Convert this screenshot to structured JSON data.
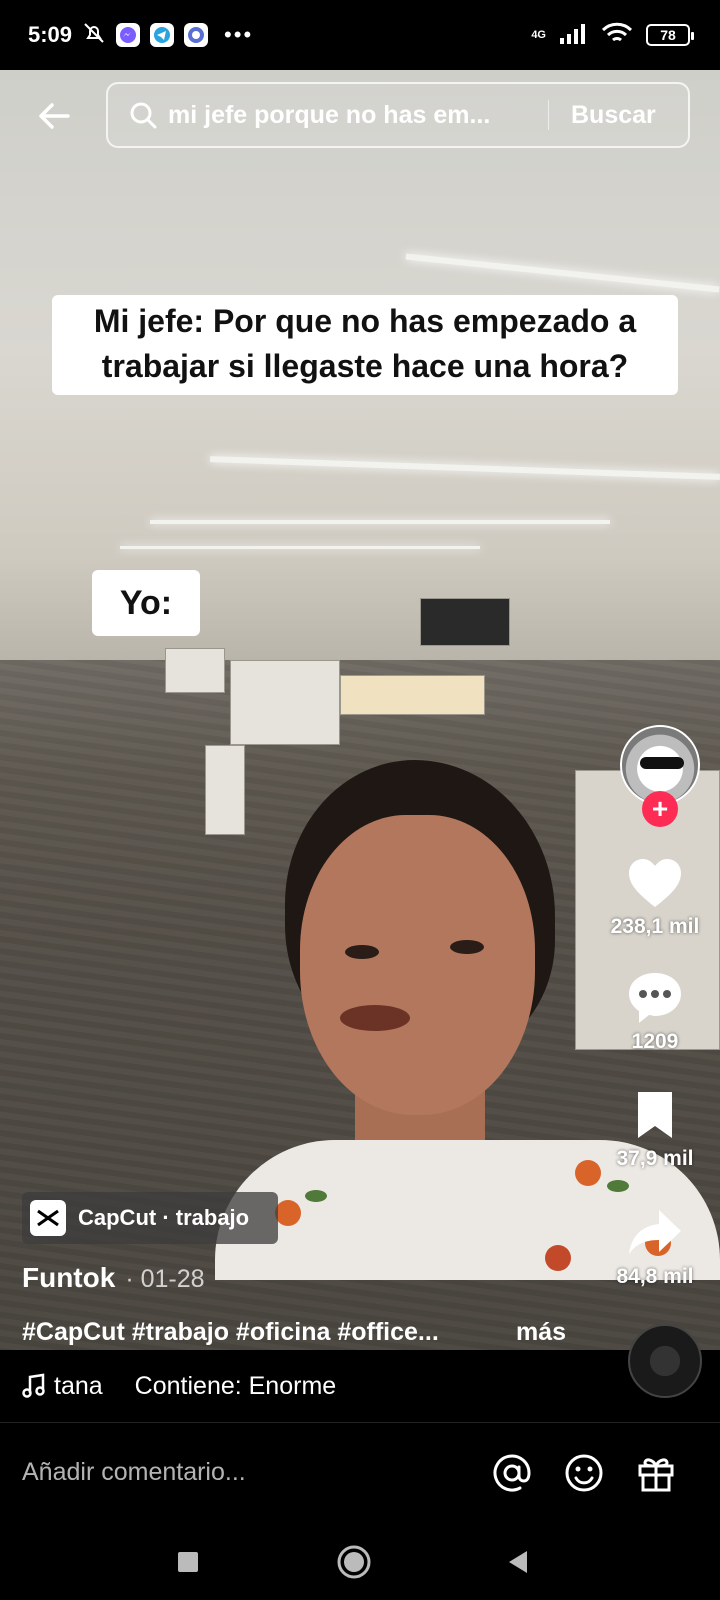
{
  "status_bar": {
    "time": "5:09",
    "network": "4G",
    "battery": "78",
    "icons_left": [
      "do-not-disturb-icon",
      "messenger-icon",
      "telegram-icon",
      "app-icon",
      "more-dots-icon"
    ],
    "icons_right": [
      "signal-icon",
      "wifi-icon",
      "battery-icon"
    ]
  },
  "search": {
    "query": "mi jefe porque no has em...",
    "button_label": "Buscar"
  },
  "video": {
    "caption_main": "Mi jefe: Por que no has empezado a trabajar si llegaste hace una hora?",
    "caption_yo": "Yo:"
  },
  "actions": {
    "likes": "238,1 mil",
    "comments": "1209",
    "saves": "37,9 mil",
    "shares": "84,8 mil",
    "follow_symbol": "+"
  },
  "post": {
    "capcut_tag": "CapCut · trabajo",
    "author": "Funtok",
    "date": "· 01-28",
    "description": "#CapCut #trabajo #oficina #office...",
    "more_label": "más"
  },
  "sound": {
    "name": "tana",
    "contains": "Contiene: Enorme"
  },
  "comment_bar": {
    "placeholder": "Añadir comentario..."
  },
  "colors": {
    "accent": "#fe2c55",
    "background": "#000000",
    "text": "#ffffff"
  }
}
